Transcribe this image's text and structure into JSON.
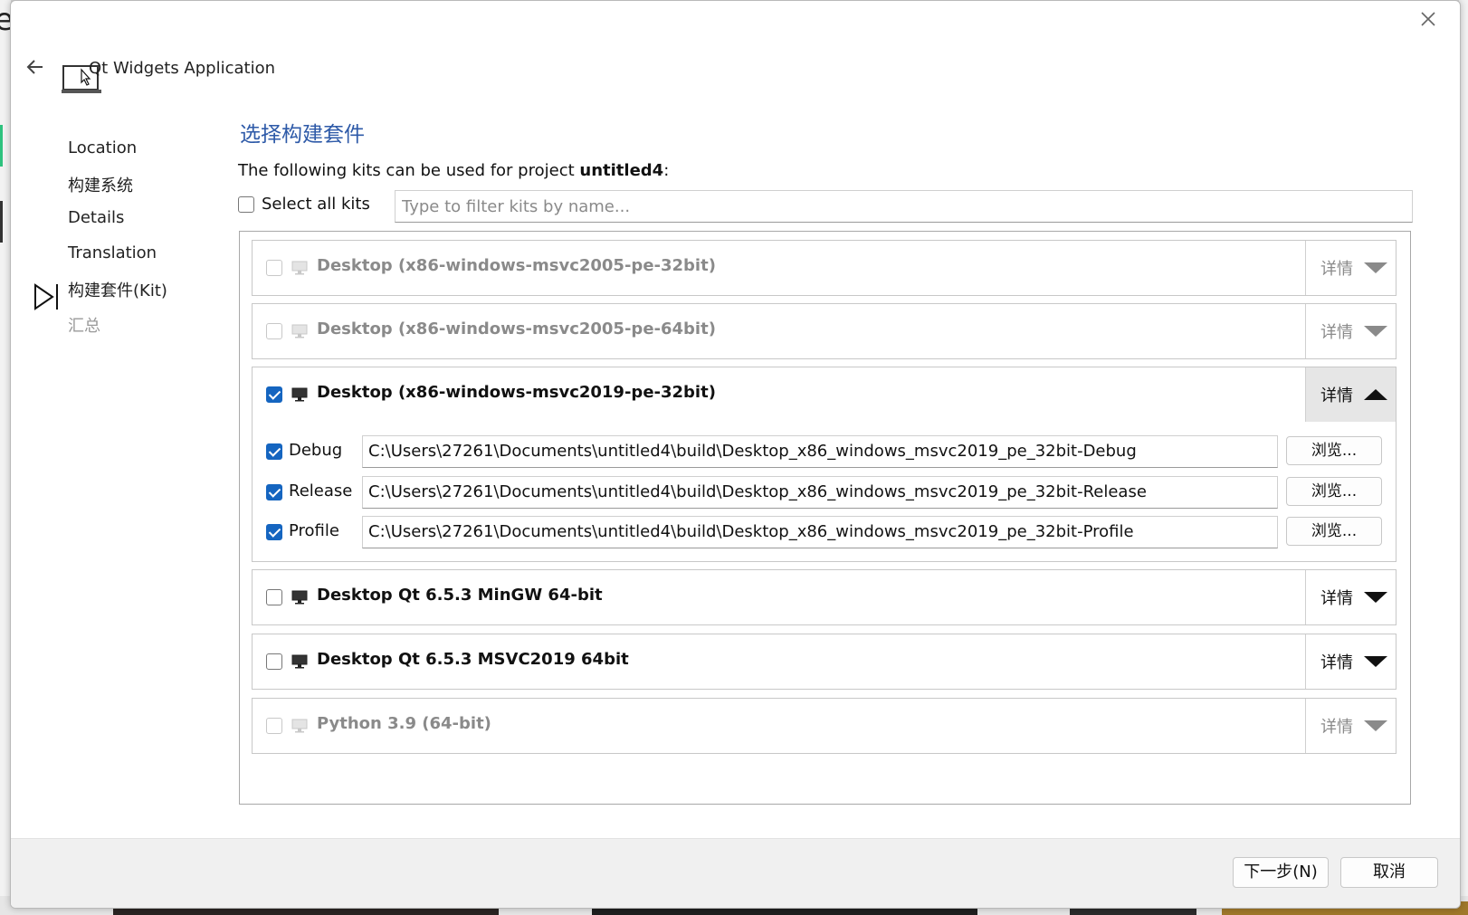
{
  "window": {
    "title": "Qt Widgets Application"
  },
  "steps": [
    {
      "label": "Location"
    },
    {
      "label": "构建系统"
    },
    {
      "label": "Details"
    },
    {
      "label": "Translation"
    },
    {
      "label": "构建套件(Kit)"
    },
    {
      "label": "汇总"
    }
  ],
  "page": {
    "heading": "选择构建套件",
    "intro_prefix": "The following kits can be used for project ",
    "project_name": "untitled4",
    "intro_suffix": ":",
    "select_all_label": "Select all kits",
    "filter_placeholder": "Type to filter kits by name..."
  },
  "kits": [
    {
      "name": "Desktop (x86-windows-msvc2005-pe-32bit)",
      "checked": false,
      "enabled": false,
      "details_label": "详情"
    },
    {
      "name": "Desktop (x86-windows-msvc2005-pe-64bit)",
      "checked": false,
      "enabled": false,
      "details_label": "详情"
    },
    {
      "name": "Desktop (x86-windows-msvc2019-pe-32bit)",
      "checked": true,
      "enabled": true,
      "expanded": true,
      "details_label": "详情"
    },
    {
      "name": "Desktop Qt 6.5.3 MinGW 64-bit",
      "checked": false,
      "enabled": true,
      "details_label": "详情"
    },
    {
      "name": "Desktop Qt 6.5.3 MSVC2019 64bit",
      "checked": false,
      "enabled": true,
      "details_label": "详情"
    },
    {
      "name": "Python 3.9 (64-bit)",
      "checked": false,
      "enabled": false,
      "details_label": "详情"
    }
  ],
  "build_configs": [
    {
      "label": "Debug",
      "checked": true,
      "path": "C:\\Users\\27261\\Documents\\untitled4\\build\\Desktop_x86_windows_msvc2019_pe_32bit-Debug",
      "browse_label": "浏览..."
    },
    {
      "label": "Release",
      "checked": true,
      "path": "C:\\Users\\27261\\Documents\\untitled4\\build\\Desktop_x86_windows_msvc2019_pe_32bit-Release",
      "browse_label": "浏览..."
    },
    {
      "label": "Profile",
      "checked": true,
      "path": "C:\\Users\\27261\\Documents\\untitled4\\build\\Desktop_x86_windows_msvc2019_pe_32bit-Profile",
      "browse_label": "浏览..."
    }
  ],
  "footer": {
    "next_label": "下一步(N)",
    "cancel_label": "取消"
  },
  "icons": {
    "close": "close-icon",
    "back": "arrow-left-icon",
    "app": "qt-widgets-app-icon",
    "monitor": "monitor-icon",
    "current_step": "current-step-triangle-icon"
  },
  "colors": {
    "heading": "#2e5aa8",
    "checkbox_checked": "#1565c0",
    "disabled_text": "#8a8a8a"
  }
}
